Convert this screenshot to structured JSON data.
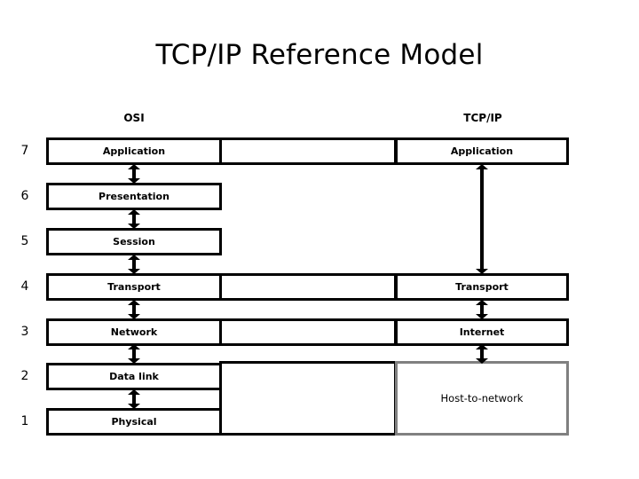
{
  "title": "TCP/IP Reference Model",
  "columns": {
    "osi_header": "OSI",
    "tcpip_header": "TCP/IP"
  },
  "colors": {
    "stroke": "#000000",
    "host_to_network_border": "#808080",
    "background": "#ffffff"
  },
  "osi_layers": [
    {
      "number": "7",
      "label": "Application"
    },
    {
      "number": "6",
      "label": "Presentation"
    },
    {
      "number": "5",
      "label": "Session"
    },
    {
      "number": "4",
      "label": "Transport"
    },
    {
      "number": "3",
      "label": "Network"
    },
    {
      "number": "2",
      "label": "Data link"
    },
    {
      "number": "1",
      "label": "Physical"
    }
  ],
  "tcpip_layers": [
    {
      "label": "Application"
    },
    {
      "label": "Transport"
    },
    {
      "label": "Internet"
    },
    {
      "label": "Host-to-network"
    }
  ]
}
